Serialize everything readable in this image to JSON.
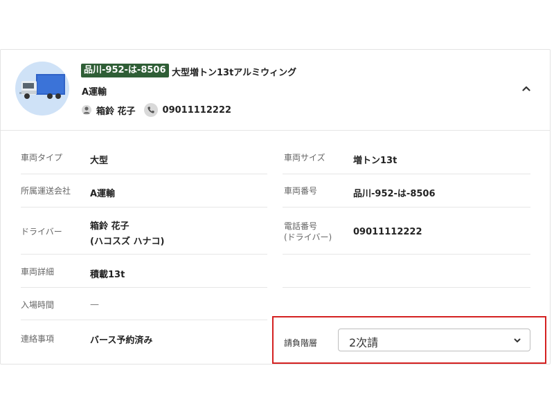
{
  "header": {
    "plate": "品川-952-は-8506",
    "vehicle_name": "大型増トン13tアルミウィング",
    "company": "A運輸",
    "driver": "箱鈴 花子",
    "phone": "09011112222"
  },
  "details": {
    "vehicle_type_label": "車両タイプ",
    "vehicle_type": "大型",
    "vehicle_size_label": "車両サイズ",
    "vehicle_size": "増トン13t",
    "carrier_label": "所属運送会社",
    "carrier": "A運輸",
    "vehicle_number_label": "車両番号",
    "vehicle_number": "品川-952-は-8506",
    "driver_label": "ドライバー",
    "driver_name": "箱鈴 花子",
    "driver_kana": "(ハコスズ ハナコ)",
    "phone_label_1": "電話番号",
    "phone_label_2": "(ドライバー)",
    "phone": "09011112222",
    "vehicle_detail_label": "車両詳細",
    "vehicle_detail": "積載13t",
    "entry_time_label": "入場時間",
    "entry_time": "—",
    "notes_label": "連絡事項",
    "notes": "バース予約済み",
    "subcontract_label": "請負階層",
    "subcontract_value": "2次請"
  },
  "colors": {
    "plate_bg": "#2f5e36",
    "highlight": "#d42020"
  },
  "icons": [
    "truck-image",
    "person-icon",
    "phone-icon",
    "chevron-up-icon",
    "chevron-down-icon"
  ]
}
